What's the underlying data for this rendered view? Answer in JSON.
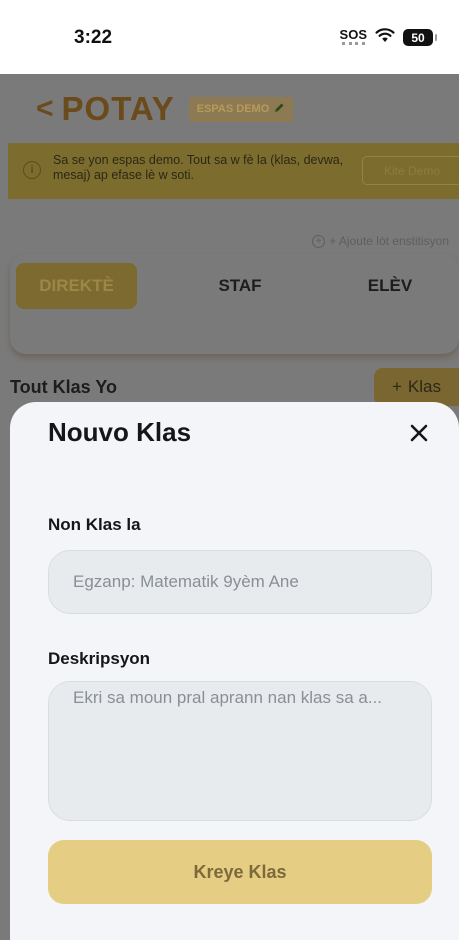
{
  "status_bar": {
    "time": "3:22",
    "sos": "SOS",
    "battery": "50"
  },
  "app": {
    "title": "POTAY",
    "demo_badge": "ESPAS DEMO",
    "banner_text": "Sa se yon espas demo. Tout sa w fè la (klas, devwa, mesaj) ap efase lè w soti.",
    "banner_button": "Kite Demo",
    "add_institution": "+ Ajoute lòt enstitisyon",
    "tabs": [
      {
        "label": "DIREKTÈ"
      },
      {
        "label": "STAF"
      },
      {
        "label": "ELÈV"
      }
    ],
    "section_title": "Tout Klas Yo",
    "add_class_button": "Klas"
  },
  "modal": {
    "title": "Nouvo Klas",
    "name_label": "Non Klas la",
    "name_placeholder": "Egzanp: Matematik 9yèm Ane",
    "description_label": "Deskripsyon",
    "description_placeholder": "Ekri sa moun pral aprann nan klas sa a...",
    "submit_label": "Kreye Klas"
  },
  "colors": {
    "accent": "#e6cd84",
    "brand": "#d4a84a",
    "sheet_bg": "#f3f5f8"
  }
}
